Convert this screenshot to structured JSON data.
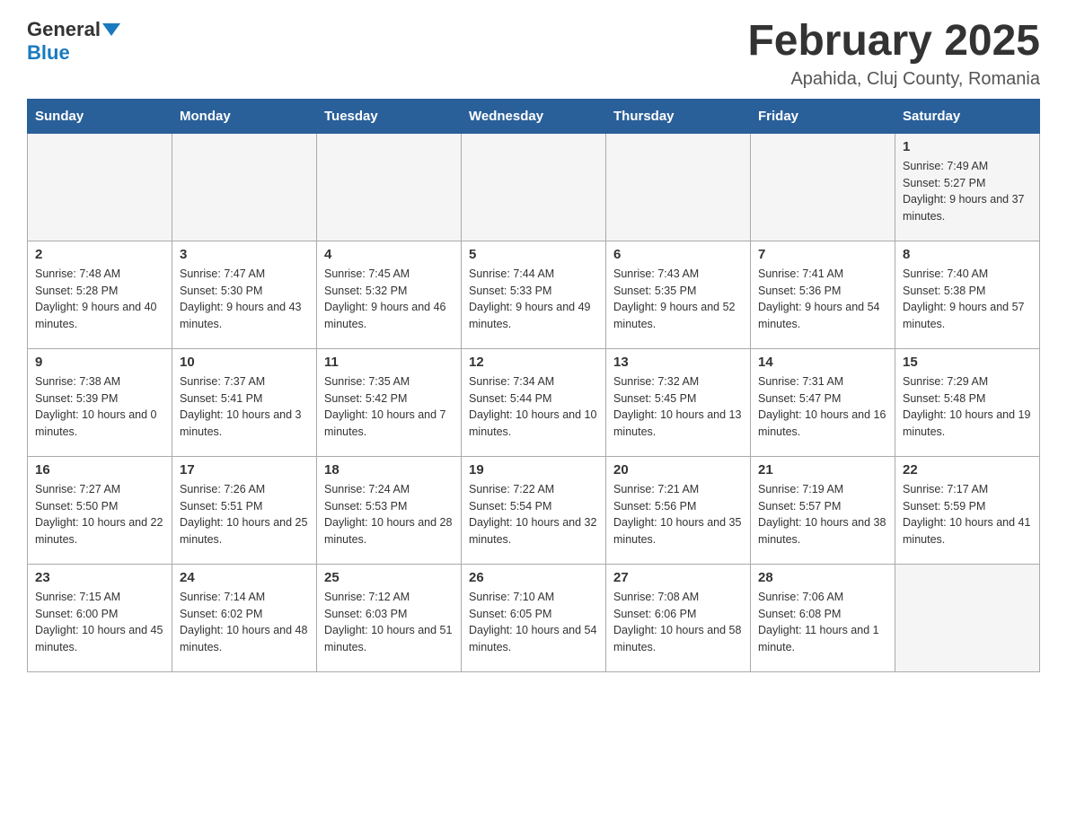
{
  "header": {
    "logo_general": "General",
    "logo_blue": "Blue",
    "title": "February 2025",
    "subtitle": "Apahida, Cluj County, Romania"
  },
  "days_of_week": [
    "Sunday",
    "Monday",
    "Tuesday",
    "Wednesday",
    "Thursday",
    "Friday",
    "Saturday"
  ],
  "weeks": [
    [
      {
        "day": "",
        "info": ""
      },
      {
        "day": "",
        "info": ""
      },
      {
        "day": "",
        "info": ""
      },
      {
        "day": "",
        "info": ""
      },
      {
        "day": "",
        "info": ""
      },
      {
        "day": "",
        "info": ""
      },
      {
        "day": "1",
        "info": "Sunrise: 7:49 AM\nSunset: 5:27 PM\nDaylight: 9 hours and 37 minutes."
      }
    ],
    [
      {
        "day": "2",
        "info": "Sunrise: 7:48 AM\nSunset: 5:28 PM\nDaylight: 9 hours and 40 minutes."
      },
      {
        "day": "3",
        "info": "Sunrise: 7:47 AM\nSunset: 5:30 PM\nDaylight: 9 hours and 43 minutes."
      },
      {
        "day": "4",
        "info": "Sunrise: 7:45 AM\nSunset: 5:32 PM\nDaylight: 9 hours and 46 minutes."
      },
      {
        "day": "5",
        "info": "Sunrise: 7:44 AM\nSunset: 5:33 PM\nDaylight: 9 hours and 49 minutes."
      },
      {
        "day": "6",
        "info": "Sunrise: 7:43 AM\nSunset: 5:35 PM\nDaylight: 9 hours and 52 minutes."
      },
      {
        "day": "7",
        "info": "Sunrise: 7:41 AM\nSunset: 5:36 PM\nDaylight: 9 hours and 54 minutes."
      },
      {
        "day": "8",
        "info": "Sunrise: 7:40 AM\nSunset: 5:38 PM\nDaylight: 9 hours and 57 minutes."
      }
    ],
    [
      {
        "day": "9",
        "info": "Sunrise: 7:38 AM\nSunset: 5:39 PM\nDaylight: 10 hours and 0 minutes."
      },
      {
        "day": "10",
        "info": "Sunrise: 7:37 AM\nSunset: 5:41 PM\nDaylight: 10 hours and 3 minutes."
      },
      {
        "day": "11",
        "info": "Sunrise: 7:35 AM\nSunset: 5:42 PM\nDaylight: 10 hours and 7 minutes."
      },
      {
        "day": "12",
        "info": "Sunrise: 7:34 AM\nSunset: 5:44 PM\nDaylight: 10 hours and 10 minutes."
      },
      {
        "day": "13",
        "info": "Sunrise: 7:32 AM\nSunset: 5:45 PM\nDaylight: 10 hours and 13 minutes."
      },
      {
        "day": "14",
        "info": "Sunrise: 7:31 AM\nSunset: 5:47 PM\nDaylight: 10 hours and 16 minutes."
      },
      {
        "day": "15",
        "info": "Sunrise: 7:29 AM\nSunset: 5:48 PM\nDaylight: 10 hours and 19 minutes."
      }
    ],
    [
      {
        "day": "16",
        "info": "Sunrise: 7:27 AM\nSunset: 5:50 PM\nDaylight: 10 hours and 22 minutes."
      },
      {
        "day": "17",
        "info": "Sunrise: 7:26 AM\nSunset: 5:51 PM\nDaylight: 10 hours and 25 minutes."
      },
      {
        "day": "18",
        "info": "Sunrise: 7:24 AM\nSunset: 5:53 PM\nDaylight: 10 hours and 28 minutes."
      },
      {
        "day": "19",
        "info": "Sunrise: 7:22 AM\nSunset: 5:54 PM\nDaylight: 10 hours and 32 minutes."
      },
      {
        "day": "20",
        "info": "Sunrise: 7:21 AM\nSunset: 5:56 PM\nDaylight: 10 hours and 35 minutes."
      },
      {
        "day": "21",
        "info": "Sunrise: 7:19 AM\nSunset: 5:57 PM\nDaylight: 10 hours and 38 minutes."
      },
      {
        "day": "22",
        "info": "Sunrise: 7:17 AM\nSunset: 5:59 PM\nDaylight: 10 hours and 41 minutes."
      }
    ],
    [
      {
        "day": "23",
        "info": "Sunrise: 7:15 AM\nSunset: 6:00 PM\nDaylight: 10 hours and 45 minutes."
      },
      {
        "day": "24",
        "info": "Sunrise: 7:14 AM\nSunset: 6:02 PM\nDaylight: 10 hours and 48 minutes."
      },
      {
        "day": "25",
        "info": "Sunrise: 7:12 AM\nSunset: 6:03 PM\nDaylight: 10 hours and 51 minutes."
      },
      {
        "day": "26",
        "info": "Sunrise: 7:10 AM\nSunset: 6:05 PM\nDaylight: 10 hours and 54 minutes."
      },
      {
        "day": "27",
        "info": "Sunrise: 7:08 AM\nSunset: 6:06 PM\nDaylight: 10 hours and 58 minutes."
      },
      {
        "day": "28",
        "info": "Sunrise: 7:06 AM\nSunset: 6:08 PM\nDaylight: 11 hours and 1 minute."
      },
      {
        "day": "",
        "info": ""
      }
    ]
  ]
}
